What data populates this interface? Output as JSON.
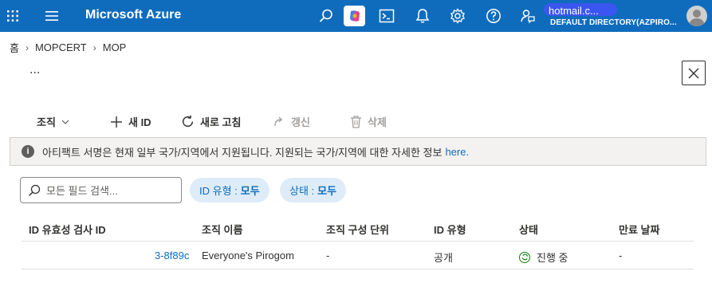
{
  "topbar": {
    "brand": "Microsoft Azure",
    "account_email": "hotmail.c...",
    "account_directory": "DEFAULT DIRECTORY(AZPIRO...",
    "icons": [
      "waffle-icon",
      "hamburger-icon",
      "search-icon",
      "copilot-icon",
      "cloud-shell-icon",
      "notifications-icon",
      "settings-icon",
      "help-icon",
      "feedback-icon",
      "avatar-icon"
    ],
    "color": "#0f6cbd"
  },
  "breadcrumb": {
    "items": [
      "홈",
      "MOPCERT",
      "MOP"
    ],
    "separator": "›"
  },
  "ellipsis": "...",
  "commands": {
    "org": "조직",
    "new_id": "새 ID",
    "refresh": "새로 고침",
    "renew": "갱신",
    "delete": "삭제"
  },
  "banner": {
    "text": "아티팩트 서명은 현재 일부 국가/지역에서 지원됩니다. 지원되는 국가/지역에 대한 자세한 정보",
    "link": "here."
  },
  "filters": {
    "search_placeholder": "모든 필드 검색...",
    "id_type_label": "ID 유형 :",
    "id_type_value": "모두",
    "status_label": "상태 :",
    "status_value": "모두"
  },
  "table": {
    "columns": [
      "ID 유효성 검사 ID",
      "조직 이름",
      "조직 구성 단위",
      "ID 유형",
      "상태",
      "만료 날짜"
    ],
    "rows": [
      {
        "id": "3-8f89c",
        "org_name": "Everyone's Pirogom",
        "unit": "-",
        "id_type": "공개",
        "status": "진행 중",
        "expiry": "-"
      }
    ]
  }
}
